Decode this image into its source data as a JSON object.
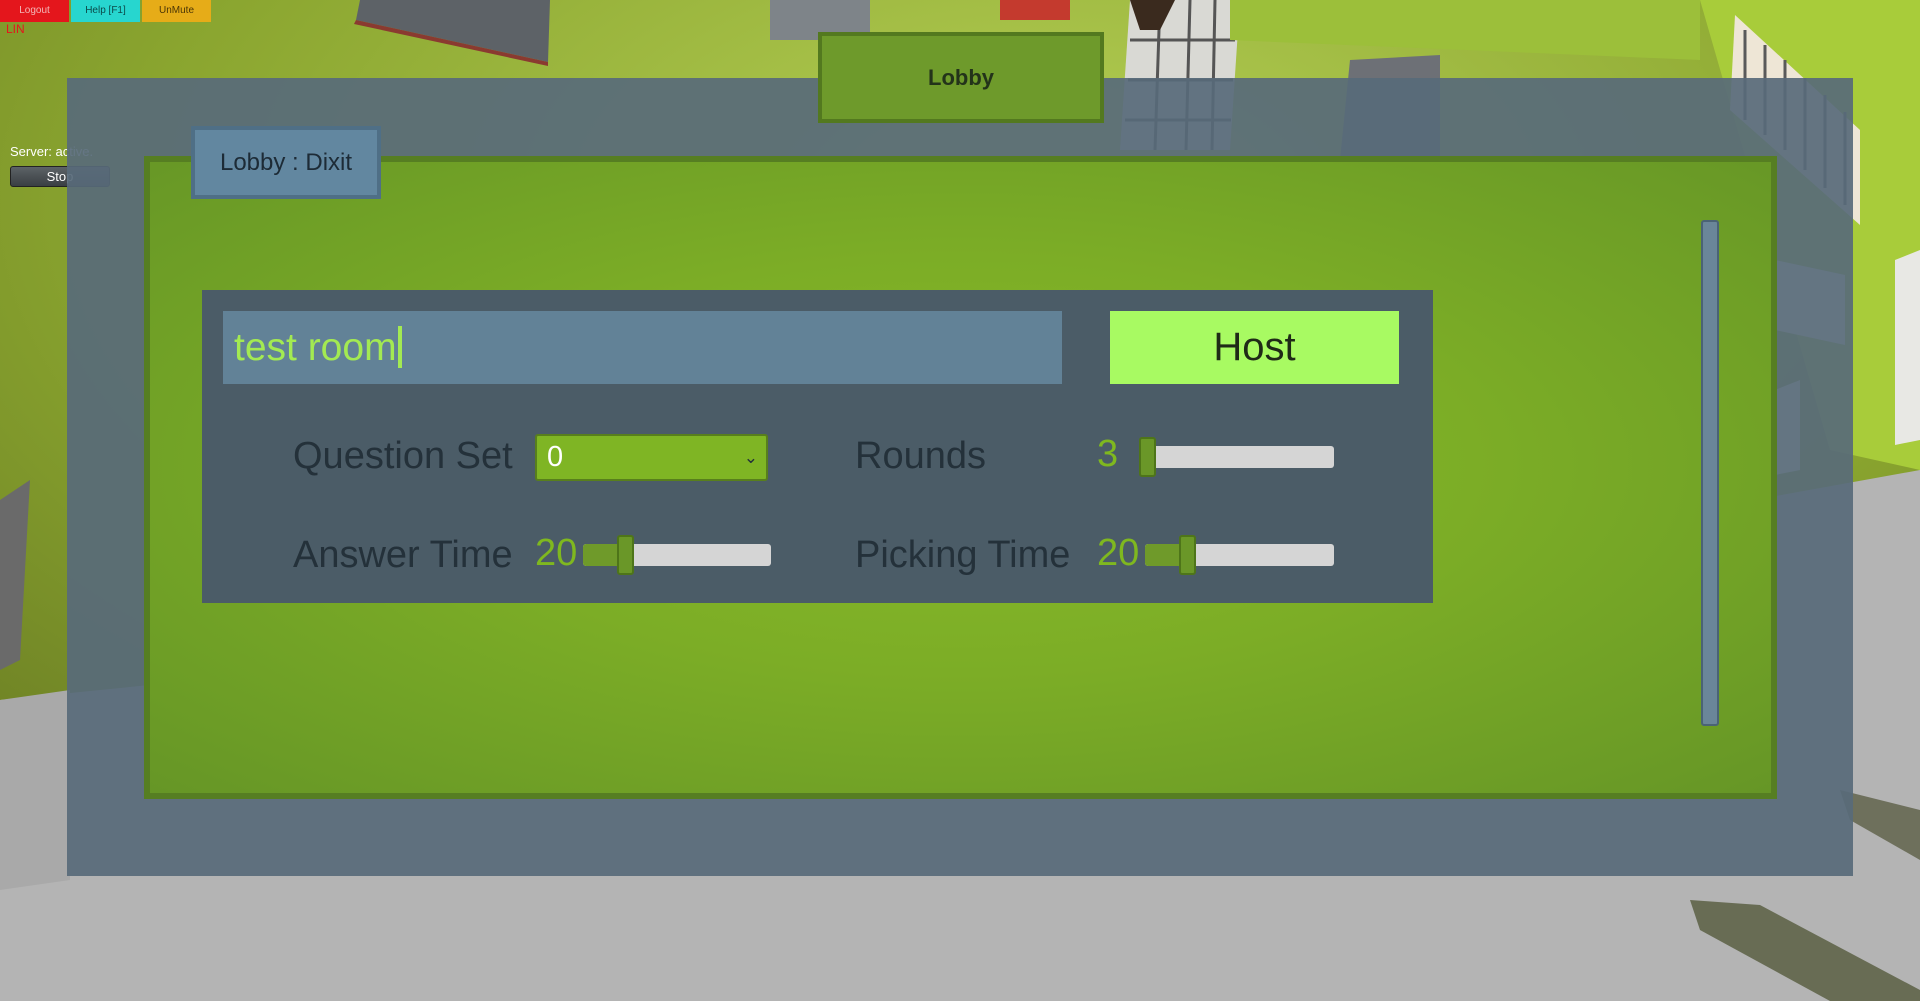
{
  "toolbar": {
    "logout_label": "Logout",
    "help_label": "Help [F1]",
    "unmute_label": "UnMute",
    "lin_label": "LIN"
  },
  "server": {
    "status_text": "Server: active.",
    "stop_label": "Stop"
  },
  "window": {
    "title": "Lobby",
    "tab_label": "Lobby : Dixit"
  },
  "room": {
    "name_value": "test room",
    "host_label": "Host"
  },
  "settings": {
    "question_set": {
      "label": "Question Set",
      "selected": "0"
    },
    "rounds": {
      "label": "Rounds",
      "value": "3",
      "fraction": 0.0
    },
    "answer_time": {
      "label": "Answer Time",
      "value": "20",
      "fraction": 0.22
    },
    "picking_time": {
      "label": "Picking Time",
      "value": "20",
      "fraction": 0.22
    }
  },
  "colors": {
    "accent_green": "#7fb524",
    "host_green": "#a8fa62",
    "panel_slate": "#4b5c67",
    "logout_red": "#e4161c",
    "help_cyan": "#27d6cf",
    "unmute_orange": "#e6ac18"
  }
}
